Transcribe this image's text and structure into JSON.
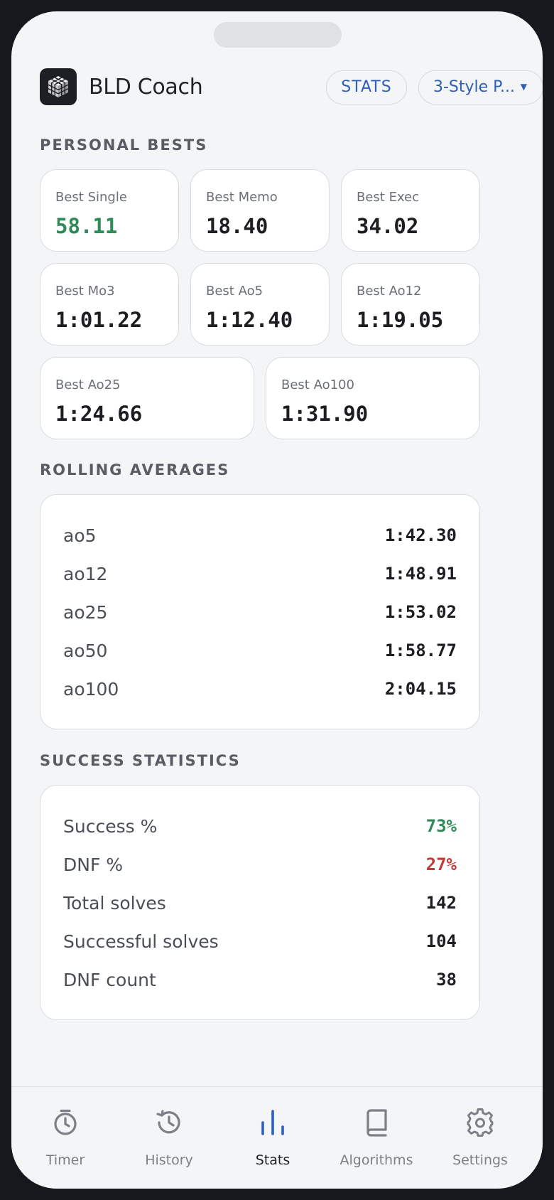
{
  "app": {
    "title": "BLD Coach",
    "stats_button": "STATS",
    "method_selector": "3-Style P..."
  },
  "sections": {
    "personal_bests": "PERSONAL BESTS",
    "rolling_averages": "ROLLING AVERAGES",
    "success_statistics": "SUCCESS STATISTICS"
  },
  "personal_bests": [
    {
      "label": "Best Single",
      "value": "58.11",
      "color": "#2e8b57"
    },
    {
      "label": "Best Memo",
      "value": "18.40"
    },
    {
      "label": "Best Exec",
      "value": "34.02"
    },
    {
      "label": "Best Mo3",
      "value": "1:01.22"
    },
    {
      "label": "Best Ao5",
      "value": "1:12.40"
    },
    {
      "label": "Best Ao12",
      "value": "1:19.05"
    },
    {
      "label": "Best Ao25",
      "value": "1:24.66"
    },
    {
      "label": "Best Ao100",
      "value": "1:31.90"
    }
  ],
  "rolling_averages": [
    {
      "label": "ao5",
      "value": "1:42.30"
    },
    {
      "label": "ao12",
      "value": "1:48.91"
    },
    {
      "label": "ao25",
      "value": "1:53.02"
    },
    {
      "label": "ao50",
      "value": "1:58.77"
    },
    {
      "label": "ao100",
      "value": "2:04.15"
    }
  ],
  "success_statistics": [
    {
      "label": "Success %",
      "value": "73%",
      "color": "#2e8b57"
    },
    {
      "label": "DNF %",
      "value": "27%",
      "color": "#c23b3b"
    },
    {
      "label": "Total solves",
      "value": "142"
    },
    {
      "label": "Successful solves",
      "value": "104"
    },
    {
      "label": "DNF count",
      "value": "38"
    }
  ],
  "tabs": [
    {
      "label": "Timer",
      "icon": "stopwatch-icon"
    },
    {
      "label": "History",
      "icon": "history-icon"
    },
    {
      "label": "Stats",
      "icon": "bar-chart-icon",
      "active": true
    },
    {
      "label": "Algorithms",
      "icon": "book-icon"
    },
    {
      "label": "Settings",
      "icon": "gear-icon"
    }
  ],
  "colors": {
    "accent": "#2f5fb6",
    "success": "#2e8b57",
    "dnf": "#c23b3b"
  }
}
